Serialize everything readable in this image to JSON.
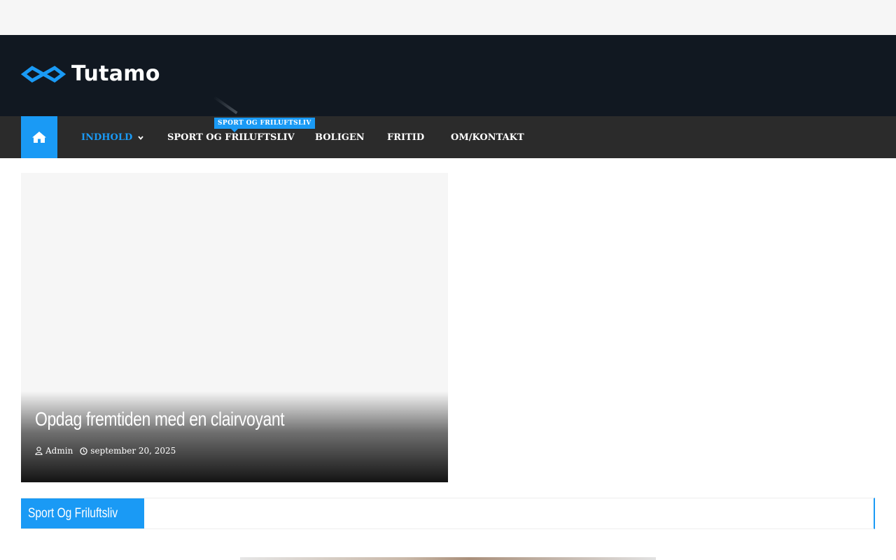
{
  "site": {
    "name": "Tutamo",
    "brand_color": "#1a9af5",
    "header_bg": "#111821",
    "nav_bg": "#2b2b2b"
  },
  "nav": {
    "home_icon": "home-icon",
    "items": [
      {
        "label": "INDHOLD",
        "active": true,
        "has_dropdown": true
      },
      {
        "label": "SPORT OG FRILUFTSLIV",
        "active": false,
        "has_dropdown": false
      },
      {
        "label": "BOLIGEN",
        "active": false,
        "has_dropdown": false
      },
      {
        "label": "FRITID",
        "active": false,
        "has_dropdown": false
      },
      {
        "label": "OM/KONTAKT",
        "active": false,
        "has_dropdown": false
      }
    ],
    "badge": "SPORT OG FRILUFTSLIV"
  },
  "featured": {
    "title": "Opdag fremtiden med en clairvoyant",
    "author": "Admin",
    "date": "september 20, 2025",
    "author_icon": "user-icon",
    "date_icon": "clock-icon"
  },
  "section": {
    "title": "Sport Og Friluftsliv"
  }
}
